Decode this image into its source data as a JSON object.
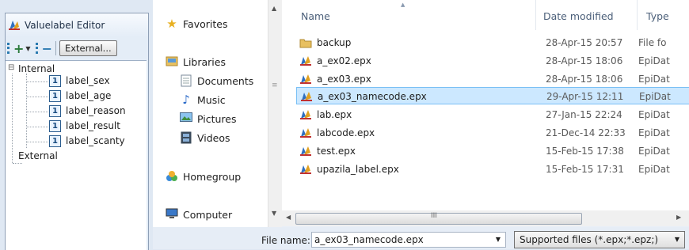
{
  "editor": {
    "title": "Valuelabel Editor",
    "toolbar": {
      "add_label": "+",
      "remove_label": "−",
      "external_label": "External..."
    },
    "tree": {
      "internal_label": "Internal",
      "items": [
        "label_sex",
        "label_age",
        "label_reason",
        "label_result",
        "label_scanty"
      ],
      "item_badge": "1",
      "external_label": "External",
      "expander": "⊟"
    }
  },
  "dialog": {
    "nav": {
      "favorites": "Favorites",
      "libraries": "Libraries",
      "documents": "Documents",
      "music": "Music",
      "pictures": "Pictures",
      "videos": "Videos",
      "homegroup": "Homegroup",
      "computer": "Computer"
    },
    "columns": {
      "name": "Name",
      "date": "Date modified",
      "type": "Type"
    },
    "files": [
      {
        "name": "backup",
        "date": "28-Apr-15 20:57",
        "type": "File fo",
        "icon": "folder-icon"
      },
      {
        "name": "a_ex02.epx",
        "date": "28-Apr-15 18:06",
        "type": "EpiDat",
        "icon": "epidata-file-icon"
      },
      {
        "name": "a_ex03.epx",
        "date": "28-Apr-15 18:06",
        "type": "EpiDat",
        "icon": "epidata-file-icon"
      },
      {
        "name": "a_ex03_namecode.epx",
        "date": "29-Apr-15 12:11",
        "type": "EpiDat",
        "icon": "epidata-file-icon",
        "selected": true
      },
      {
        "name": "lab.epx",
        "date": "27-Jan-15 22:24",
        "type": "EpiDat",
        "icon": "epidata-file-icon"
      },
      {
        "name": "labcode.epx",
        "date": "21-Dec-14 22:33",
        "type": "EpiDat",
        "icon": "epidata-file-icon"
      },
      {
        "name": "test.epx",
        "date": "15-Feb-15 17:38",
        "type": "EpiDat",
        "icon": "epidata-file-icon"
      },
      {
        "name": "upazila_label.epx",
        "date": "15-Feb-15 17:31",
        "type": "EpiDat",
        "icon": "epidata-file-icon"
      }
    ],
    "hscroll_grip": "III",
    "file_name_label": "File name:",
    "file_name_value": "a_ex03_namecode.epx",
    "filter": "Supported files (*.epx;*.epz;)"
  }
}
